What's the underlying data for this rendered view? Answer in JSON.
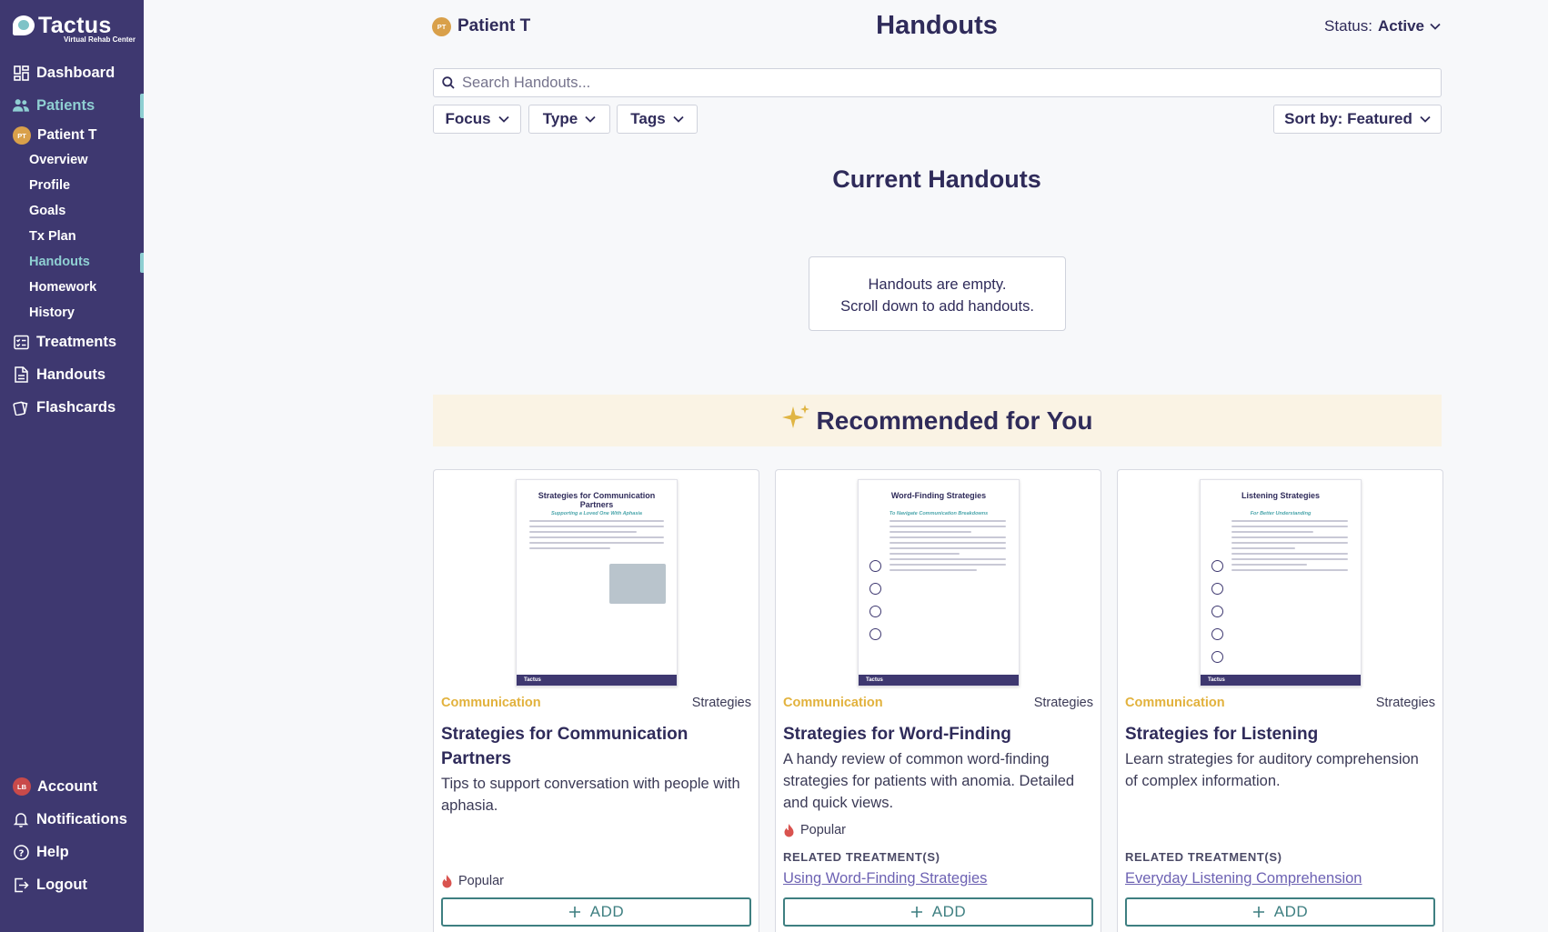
{
  "brand": {
    "name": "Tactus",
    "tagline": "Virtual Rehab Center"
  },
  "colors": {
    "sidebar": "#3e3870",
    "accent": "#8fcfd2",
    "category": "#e2b23d",
    "add_button": "#3e7f81",
    "banner": "#faf3e4"
  },
  "sidebar": {
    "dashboard": "Dashboard",
    "patients": "Patients",
    "patient": {
      "initials": "PT",
      "name": "Patient T"
    },
    "sub_items": [
      "Overview",
      "Profile",
      "Goals",
      "Tx Plan",
      "Handouts",
      "Homework",
      "History"
    ],
    "treatments": "Treatments",
    "handouts": "Handouts",
    "flashcards": "Flashcards",
    "account": {
      "initials": "LB",
      "label": "Account"
    },
    "notifications": "Notifications",
    "help": "Help",
    "logout": "Logout"
  },
  "header": {
    "patient_initials": "PT",
    "patient_name": "Patient T",
    "title": "Handouts",
    "status_label": "Status:",
    "status_value": "Active"
  },
  "search": {
    "placeholder": "Search Handouts..."
  },
  "filters": {
    "focus": "Focus",
    "type": "Type",
    "tags": "Tags",
    "sort": "Sort by: Featured"
  },
  "current": {
    "title": "Current Handouts",
    "empty_line1": "Handouts are empty.",
    "empty_line2": "Scroll down to add handouts."
  },
  "recommended": {
    "title": "Recommended for You"
  },
  "cards": [
    {
      "thumb_title": "Strategies for Communication Partners",
      "thumb_sub": "Supporting a Loved One With Aphasia",
      "category": "Communication",
      "type": "Strategies",
      "title": "Strategies for Communication Partners",
      "description": "Tips to support conversation with people with aphasia.",
      "popular": "Popular",
      "add": "ADD"
    },
    {
      "thumb_title": "Word-Finding Strategies",
      "thumb_sub": "To Navigate Communication Breakdowns",
      "category": "Communication",
      "type": "Strategies",
      "title": "Strategies for Word-Finding",
      "description": "A handy review of common word-finding strategies for patients with anomia. Detailed and quick views.",
      "popular": "Popular",
      "related_label": "RELATED TREATMENT(S)",
      "related_link": "Using Word-Finding Strategies",
      "add": "ADD"
    },
    {
      "thumb_title": "Listening Strategies",
      "thumb_sub": "For Better Understanding",
      "category": "Communication",
      "type": "Strategies",
      "title": "Strategies for Listening",
      "description": "Learn strategies for auditory comprehension of complex information.",
      "related_label": "RELATED TREATMENT(S)",
      "related_link": "Everyday Listening Comprehension",
      "add": "ADD"
    }
  ],
  "thumb_footer": "Tactus"
}
